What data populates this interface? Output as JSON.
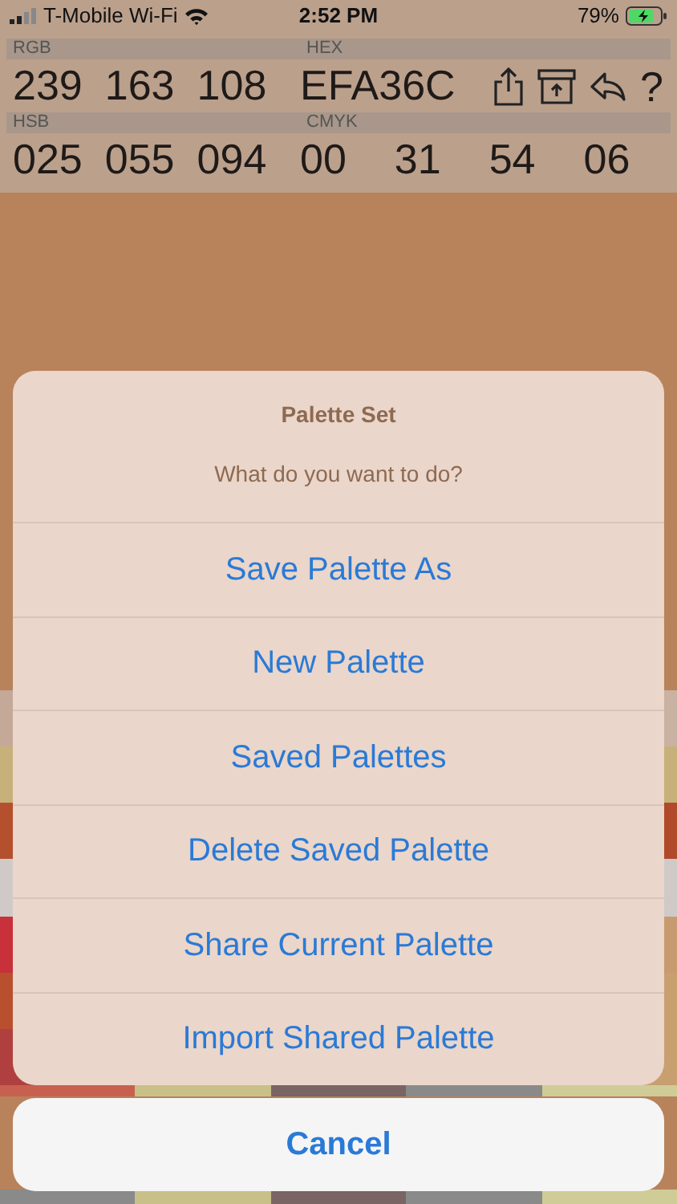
{
  "status_bar": {
    "carrier": "T-Mobile Wi-Fi",
    "time": "2:52 PM",
    "battery": "79%"
  },
  "color_info": {
    "groups": [
      {
        "label": "RGB",
        "values": [
          "239",
          "163",
          "108"
        ]
      },
      {
        "label": "HEX",
        "values": [
          "EFA36C"
        ]
      },
      {
        "label": "HSB",
        "values": [
          "025",
          "055",
          "094"
        ]
      },
      {
        "label": "CMYK",
        "values": [
          "00",
          "31",
          "54",
          "06"
        ]
      }
    ],
    "help": "?"
  },
  "palette": [
    {
      "swatches": [
        {
          "color": "#c4a898"
        },
        {
          "color": "#c9b2a2"
        }
      ]
    },
    {
      "swatches": [
        {
          "color": "#c8b07a"
        },
        {
          "color": "#c8b07a"
        }
      ]
    },
    {
      "swatches": [
        {
          "color": "#b5502f"
        },
        {
          "color": "#b04a2a"
        }
      ]
    },
    {
      "swatches": [
        {
          "color": "#cfcac8"
        },
        {
          "color": "#cfcac8"
        }
      ]
    },
    {
      "swatches": [
        {
          "color": "#c8303a"
        },
        {
          "color": "#c89a70"
        }
      ]
    },
    {
      "swatches": [
        {
          "color": "#b85030"
        },
        {
          "color": "#c8a070"
        }
      ]
    },
    {
      "swatches": [
        {
          "color": "#b04040"
        },
        {
          "color": "#c8a070"
        }
      ]
    },
    {
      "swatches": [
        {
          "color": "#c86050"
        },
        {
          "color": "#c8c088"
        },
        {
          "color": "#7a6464"
        },
        {
          "color": "#8a8a8a"
        },
        {
          "color": "#cfcc98"
        }
      ]
    },
    {
      "swatches": [
        {
          "color": "#8a8a8a"
        },
        {
          "color": "#c8c088"
        },
        {
          "color": "#7a6464"
        },
        {
          "color": "#8a8a8a"
        },
        {
          "color": "#cfcc98"
        }
      ]
    }
  ],
  "action_sheet": {
    "title": "Palette Set",
    "message": "What do you want to do?",
    "actions": [
      "Save Palette As",
      "New Palette",
      "Saved Palettes",
      "Delete Saved Palette",
      "Share Current Palette",
      "Import Shared Palette"
    ],
    "cancel": "Cancel"
  }
}
